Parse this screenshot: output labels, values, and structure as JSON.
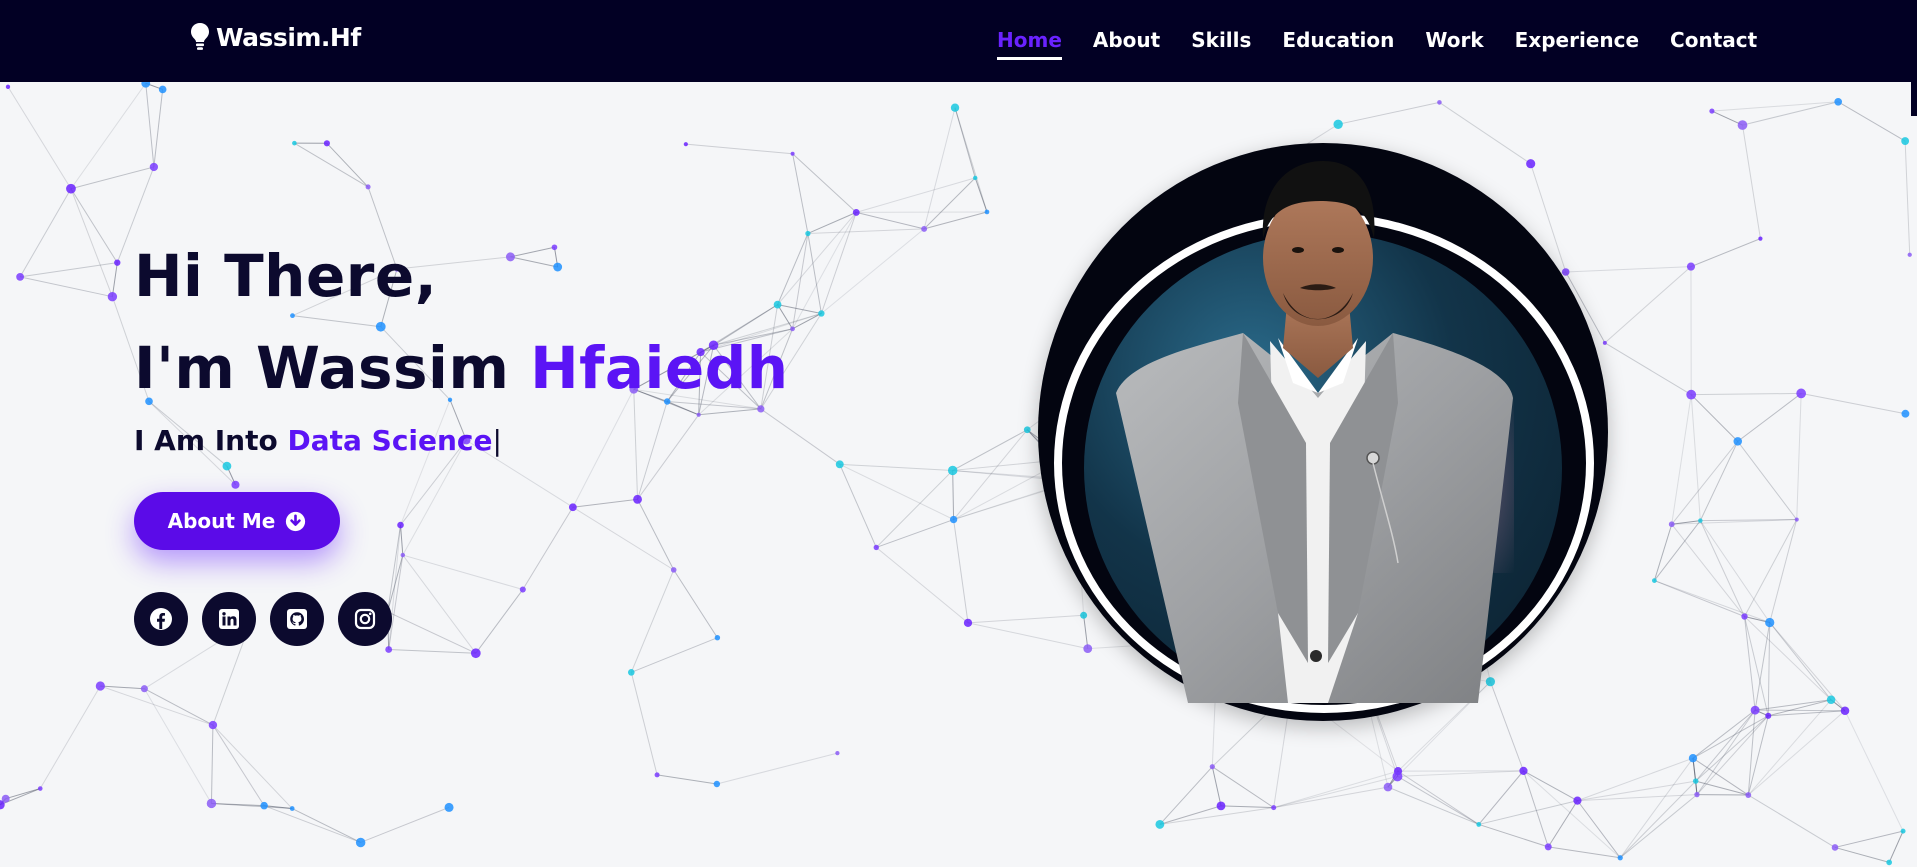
{
  "header": {
    "logo_text": "Wassim.Hf",
    "logo_icon": "lightbulb-icon",
    "nav": [
      {
        "label": "Home",
        "active": true
      },
      {
        "label": "About"
      },
      {
        "label": "Skills"
      },
      {
        "label": "Education"
      },
      {
        "label": "Work"
      },
      {
        "label": "Experience"
      },
      {
        "label": "Contact"
      }
    ]
  },
  "hero": {
    "greeting_line1": "Hi There,",
    "greeting_line2_prefix": "I'm Wassim ",
    "greeting_line2_accent": "Hfaiedh",
    "tagline_prefix": "I Am Into ",
    "tagline_accent": "Data Science",
    "tagline_cursor": "|",
    "about_button": "About Me",
    "about_button_icon": "arrow-circle-down-icon"
  },
  "socials": [
    {
      "icon": "facebook-icon"
    },
    {
      "icon": "linkedin-icon"
    },
    {
      "icon": "github-icon"
    },
    {
      "icon": "instagram-icon"
    }
  ],
  "colors": {
    "navbar": "#020024",
    "accent": "#5b14f5",
    "text_dark": "#0c0a2e",
    "background": "#f5f6f8"
  }
}
